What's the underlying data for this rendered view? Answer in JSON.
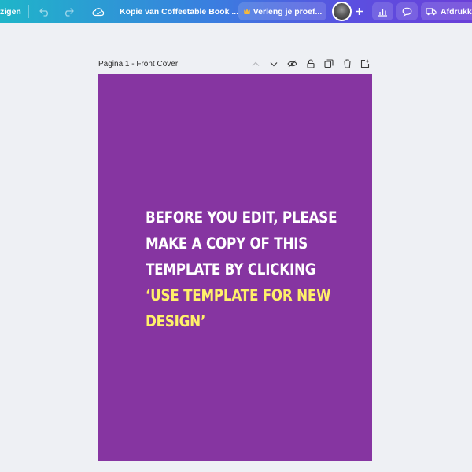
{
  "topbar": {
    "left_partial": "zigen",
    "design_title": "Kopie van Coffeetable Book ...",
    "trial_button": "Verleng je proef...",
    "print_button": "Afdrukke"
  },
  "page": {
    "label": "Pagina 1 - Front Cover"
  },
  "canvas": {
    "background": "#8635a1",
    "lines": [
      {
        "text": "BEFORE YOU EDIT, PLEASE",
        "color": "white"
      },
      {
        "text": "MAKE A COPY OF THIS",
        "color": "white"
      },
      {
        "text": "TEMPLATE BY CLICKING",
        "color": "white"
      },
      {
        "text": "‘USE TEMPLATE FOR NEW",
        "color": "yellow"
      },
      {
        "text": "DESIGN’",
        "color": "yellow"
      }
    ]
  },
  "colors": {
    "topbar_start": "#1fb5c9",
    "topbar_end": "#6a3fd8",
    "highlight_text": "#fff06a"
  },
  "icons": [
    "undo-icon",
    "redo-icon",
    "cloud-save-icon",
    "crown-icon",
    "plus-icon",
    "analytics-icon",
    "comment-icon",
    "truck-icon",
    "chevron-up-icon",
    "chevron-down-icon",
    "hide-icon",
    "lock-icon",
    "duplicate-icon",
    "trash-icon",
    "add-page-icon"
  ]
}
